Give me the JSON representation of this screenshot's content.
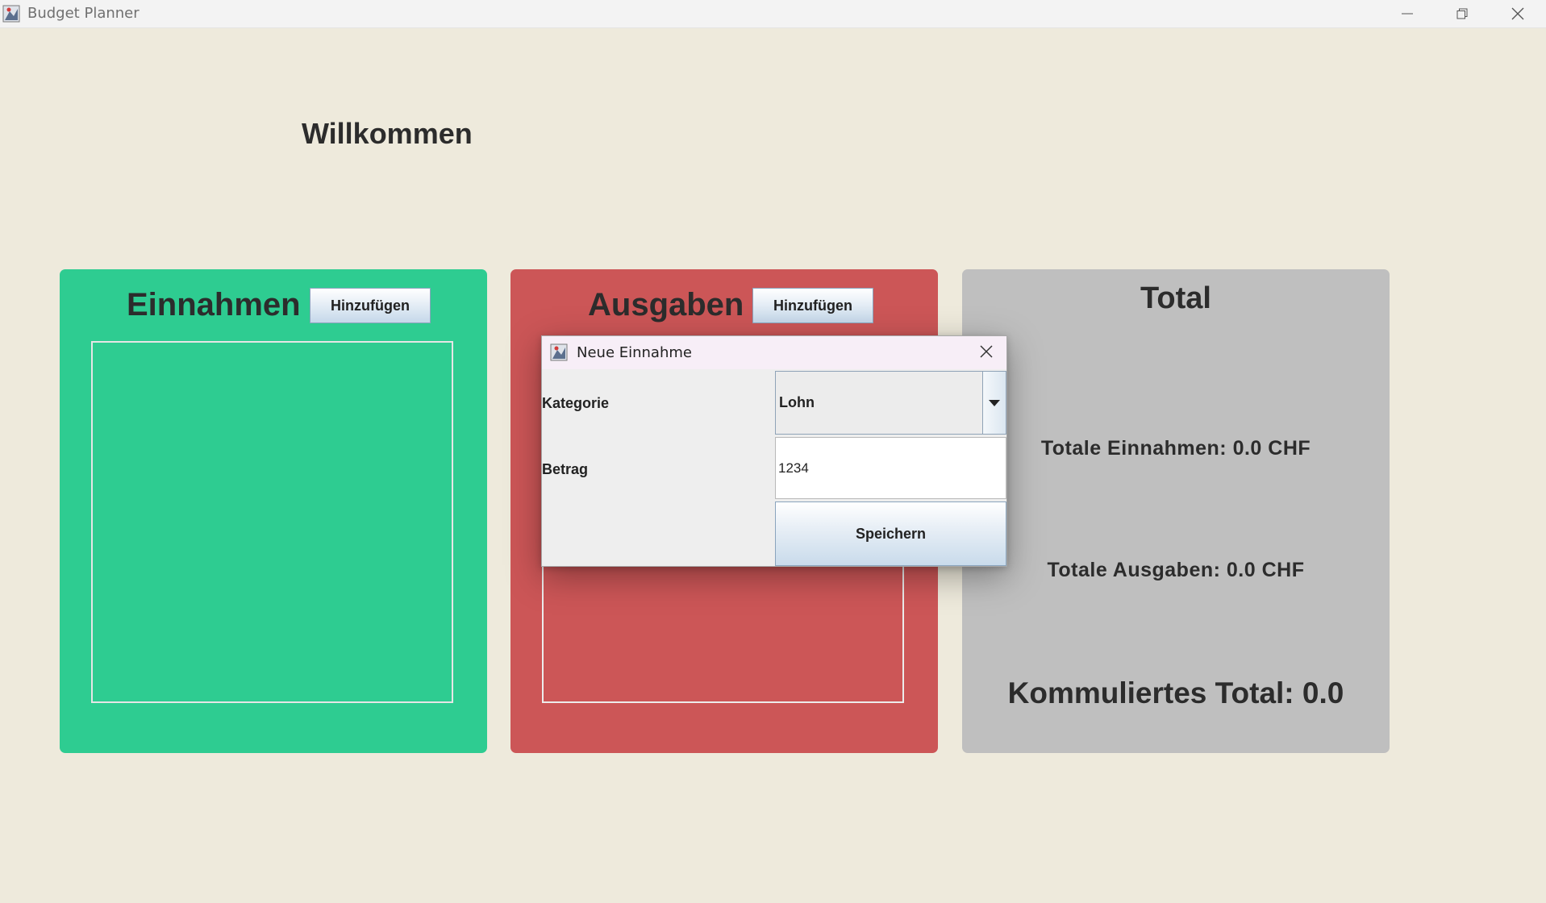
{
  "window": {
    "title": "Budget Planner"
  },
  "main": {
    "welcome": "Willkommen",
    "income": {
      "heading": "Einnahmen",
      "add_label": "Hinzufügen"
    },
    "expenses": {
      "heading": "Ausgaben",
      "add_label": "Hinzufügen"
    },
    "total": {
      "heading": "Total",
      "income_line": "Totale Einnahmen: 0.0 CHF",
      "expenses_line": "Totale Ausgaben: 0.0 CHF",
      "cumulative_line": "Kommuliertes Total: 0.0"
    }
  },
  "dialog": {
    "title": "Neue Einnahme",
    "category_label": "Kategorie",
    "category_value": "Lohn",
    "amount_label": "Betrag",
    "amount_value": "1234",
    "save_label": "Speichern"
  },
  "colors": {
    "background": "#eeeadc",
    "income_panel": "#2ecc91",
    "expenses_panel": "#cc5657",
    "total_panel": "#bfbfbf"
  },
  "icons": [
    "app-icon",
    "minimize-icon",
    "restore-icon",
    "close-icon",
    "dropdown-arrow-icon"
  ]
}
